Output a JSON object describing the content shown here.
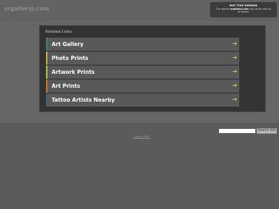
{
  "header": {
    "site_name": "srgalleryj.com"
  },
  "buy_box": {
    "title": "BUY THIS DOMAIN",
    "text_prefix": "The domain ",
    "domain": "srgalleryj.com",
    "text_suffix": " may be for sale by its owner!"
  },
  "related": {
    "title": "Related Links",
    "links": [
      {
        "label": "Art Gallery",
        "accent": "#2e8b8b",
        "arrow": "➔"
      },
      {
        "label": "Photo Prints",
        "accent": "#c8b82a",
        "arrow": "➔"
      },
      {
        "label": "Artwork Prints",
        "accent": "#b7c93a",
        "arrow": "➔"
      },
      {
        "label": "Art Prints",
        "accent": "#d07a2a",
        "arrow": "➔"
      },
      {
        "label": "Tattoo Artists Nearby",
        "accent": "#2e6f86",
        "arrow": "➔"
      }
    ]
  },
  "search": {
    "value": "",
    "button_label": "Search Ads"
  },
  "footer": {
    "privacy_label": "Privacy Policy"
  }
}
